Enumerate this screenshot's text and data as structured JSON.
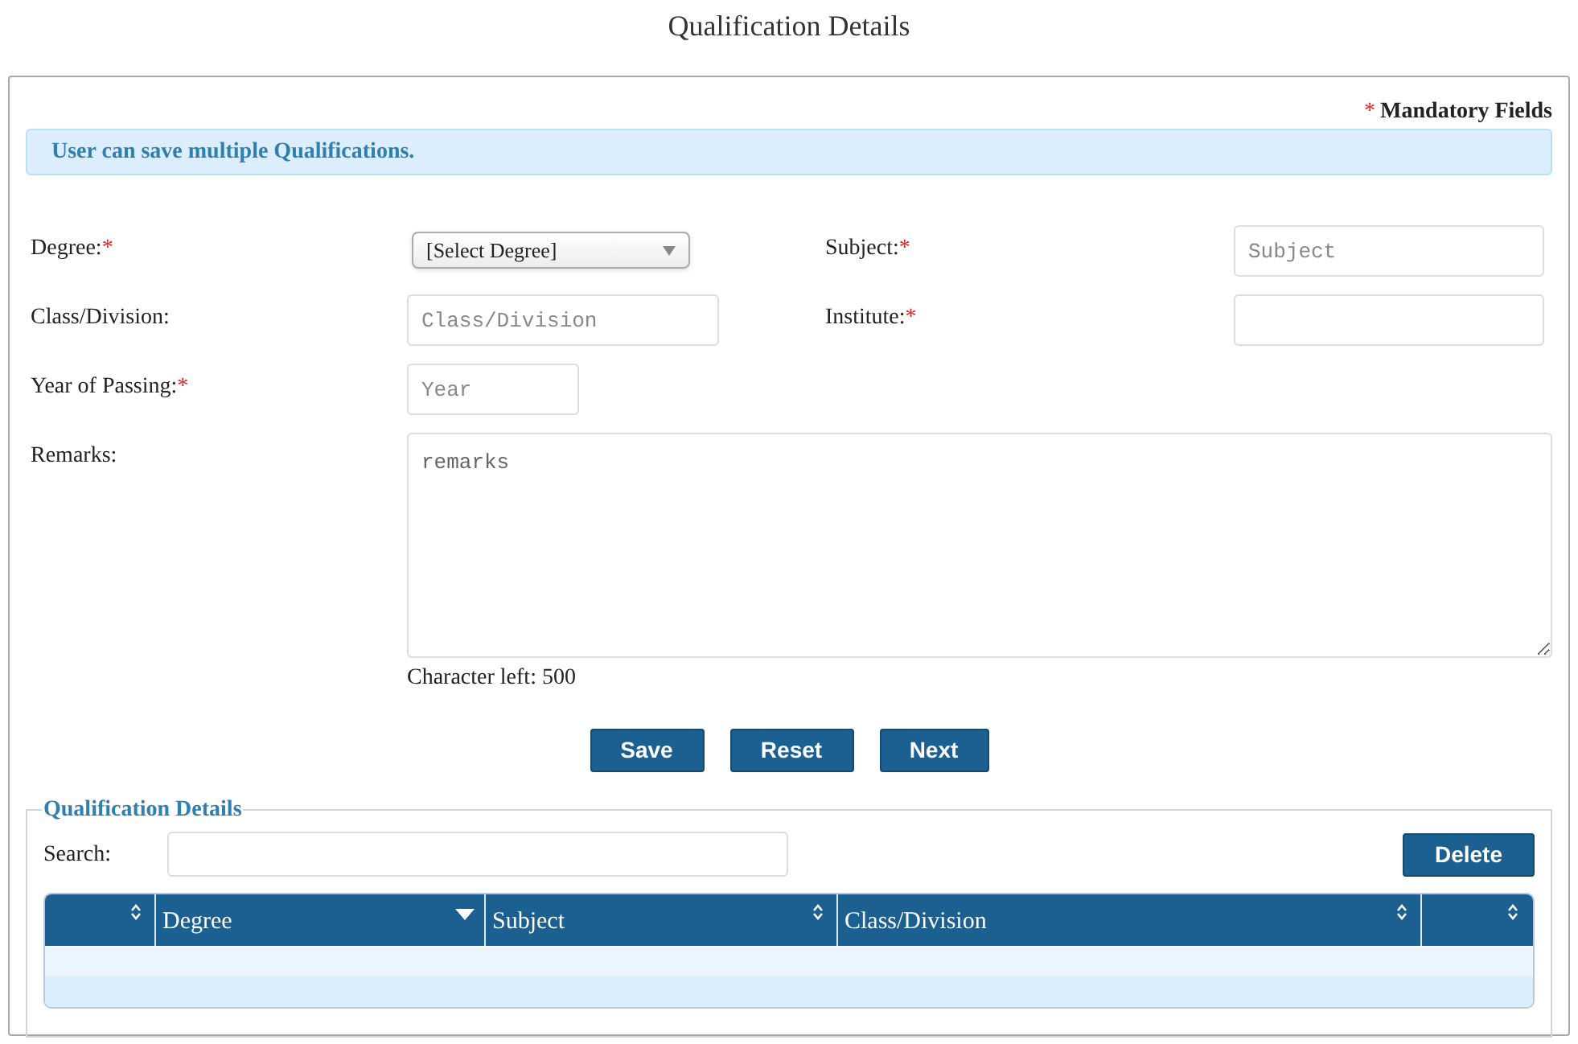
{
  "title": "Qualification Details",
  "mandatory_note": {
    "mark": "*",
    "text": "Mandatory Fields"
  },
  "info": "User can save multiple Qualifications.",
  "form": {
    "rows": [
      [
        {
          "kind": "select",
          "label": "Degree:",
          "required_mark": "*",
          "value": "[Select Degree]"
        },
        {
          "kind": "input",
          "label": "Subject:",
          "required_mark": "*",
          "placeholder": "Subject"
        }
      ],
      [
        {
          "kind": "input",
          "label": "Class/Division:",
          "placeholder": "Class/Division"
        },
        {
          "kind": "input",
          "label": "Institute:",
          "required_mark": "*"
        }
      ],
      [
        {
          "kind": "input",
          "label": "Year of Passing:",
          "required_mark": "*",
          "placeholder": "Year"
        }
      ],
      [
        {
          "kind": "textarea",
          "label": "Remarks:",
          "placeholder": "remarks",
          "counter": "Character left: 500"
        }
      ]
    ]
  },
  "buttons": [
    "Save",
    "Reset",
    "Next"
  ],
  "details": {
    "legend": "Qualification Details",
    "search_label": "Search:",
    "delete_button": "Delete",
    "columns": [
      {
        "sorted_descending": false
      },
      {
        "label": "Degree",
        "sorted_descending": true
      },
      {
        "label": "Subject",
        "sorted_descending": false
      },
      {
        "label": "Class/Division",
        "sorted_descending": false
      },
      {
        "sorted_descending": false
      }
    ],
    "rows": [
      {
        "striped": false
      },
      {
        "striped": true
      }
    ]
  }
}
